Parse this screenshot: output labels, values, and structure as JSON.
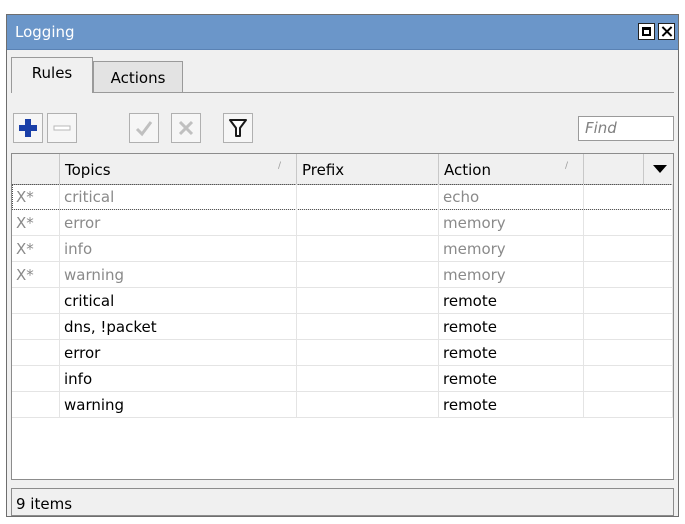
{
  "window": {
    "title": "Logging"
  },
  "tabs": [
    {
      "label": "Rules",
      "active": true
    },
    {
      "label": "Actions",
      "active": false
    }
  ],
  "toolbar": {
    "add_icon": "plus-icon",
    "remove_icon": "minus-icon",
    "enable_icon": "check-icon",
    "disable_icon": "x-icon",
    "filter_icon": "funnel-icon",
    "find_placeholder": "Find"
  },
  "table": {
    "columns": [
      "",
      "Topics",
      "Prefix",
      "Action",
      ""
    ],
    "rows": [
      {
        "flags": "X*",
        "topics": "critical",
        "prefix": "",
        "action": "echo",
        "disabled": true
      },
      {
        "flags": "X*",
        "topics": "error",
        "prefix": "",
        "action": "memory",
        "disabled": true
      },
      {
        "flags": "X*",
        "topics": "info",
        "prefix": "",
        "action": "memory",
        "disabled": true
      },
      {
        "flags": "X*",
        "topics": "warning",
        "prefix": "",
        "action": "memory",
        "disabled": true
      },
      {
        "flags": "",
        "topics": "critical",
        "prefix": "",
        "action": "remote",
        "disabled": false
      },
      {
        "flags": "",
        "topics": "dns, !packet",
        "prefix": "",
        "action": "remote",
        "disabled": false
      },
      {
        "flags": "",
        "topics": "error",
        "prefix": "",
        "action": "remote",
        "disabled": false
      },
      {
        "flags": "",
        "topics": "info",
        "prefix": "",
        "action": "remote",
        "disabled": false
      },
      {
        "flags": "",
        "topics": "warning",
        "prefix": "",
        "action": "remote",
        "disabled": false
      }
    ]
  },
  "status": {
    "count_text": "9 items"
  },
  "colors": {
    "titlebar": "#6b96c9",
    "add_blue": "#1a3fa8",
    "disabled_text": "#8a8a8a"
  }
}
